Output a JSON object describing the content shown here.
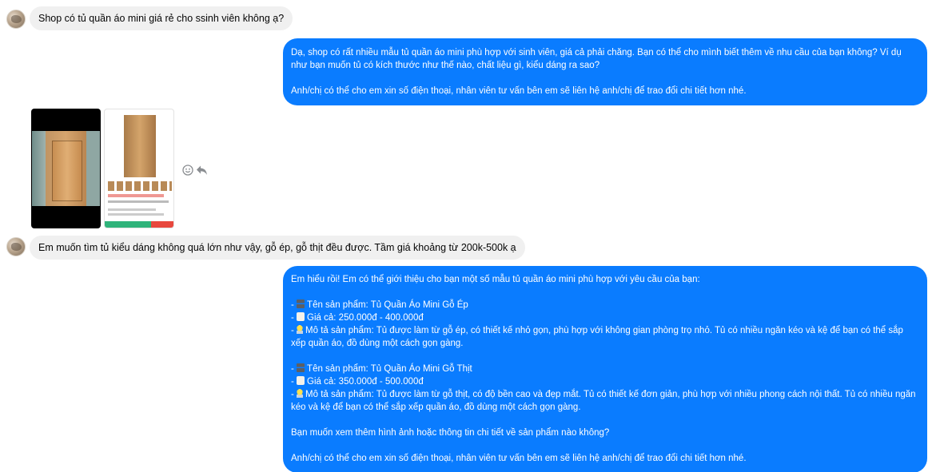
{
  "messages": {
    "m1": {
      "text": "Shop có tủ quần áo mini giá rẻ cho ssinh viên không ạ?"
    },
    "m2": {
      "line1": "Dạ, shop có rất nhiều mẫu tủ quần áo mini phù hợp với sinh viên, giá cả phải chăng. Bạn có thể cho mình biết thêm về nhu cầu của bạn không? Ví dụ như bạn muốn tủ có kích thước như thế nào, chất liệu gì, kiểu dáng ra sao?",
      "line2": "Anh/chị có thể cho em xin số điện thoại, nhân viên tư vấn bên em sẽ liên hệ anh/chị để trao đổi chi tiết hơn nhé."
    },
    "m3": {
      "text": "Em muốn tìm tủ kiểu dáng không quá lớn như vậy, gỗ ép, gỗ thịt đều được. Tầm giá khoảng từ 200k-500k ạ"
    },
    "m4": {
      "intro": "Em hiểu rồi! Em có thể giới thiệu cho bạn một số mẫu tủ quần áo mini phù hợp với yêu cầu của bạn:",
      "p1_name": "Tên sản phẩm: Tủ Quần Áo Mini Gỗ Ép",
      "p1_price": "Giá cả: 250.000đ - 400.000đ",
      "p1_desc": "Mô tả sản phẩm: Tủ được làm từ gỗ ép, có thiết kế nhỏ gọn, phù hợp với không gian phòng trọ nhỏ. Tủ có nhiều ngăn kéo và kệ để bạn có thể sắp xếp quần áo, đồ dùng một cách gọn gàng.",
      "p2_name": "Tên sản phẩm: Tủ Quần Áo Mini Gỗ Thịt",
      "p2_price": "Giá cả: 350.000đ - 500.000đ",
      "p2_desc": "Mô tả sản phẩm: Tủ được làm từ gỗ thịt, có độ bền cao và đẹp mắt. Tủ có thiết kế đơn giản, phù hợp với nhiều phong cách nội thất. Tủ có nhiều ngăn kéo và kệ để bạn có thể sắp xếp quần áo, đồ dùng một cách gọn gàng.",
      "question": "Bạn muốn xem thêm hình ảnh hoặc thông tin chi tiết về sản phẩm nào không?",
      "closing": "Anh/chị có thể cho em xin số điện thoại, nhân viên tư vấn bên em sẽ liên hệ anh/chị để trao đổi chi tiết hơn nhé."
    }
  },
  "list": {
    "dash": "-"
  },
  "icons": {
    "avatar": "user-avatar",
    "react": "smiley-react-icon",
    "reply": "reply-arrow-icon",
    "item_name": "chair-icon",
    "item_price": "price-tag-icon",
    "item_desc": "light-bulb-icon"
  },
  "colors": {
    "outgoing_bubble": "#0a7cff",
    "incoming_bubble": "#f0f0f0",
    "background": "#ffffff"
  }
}
